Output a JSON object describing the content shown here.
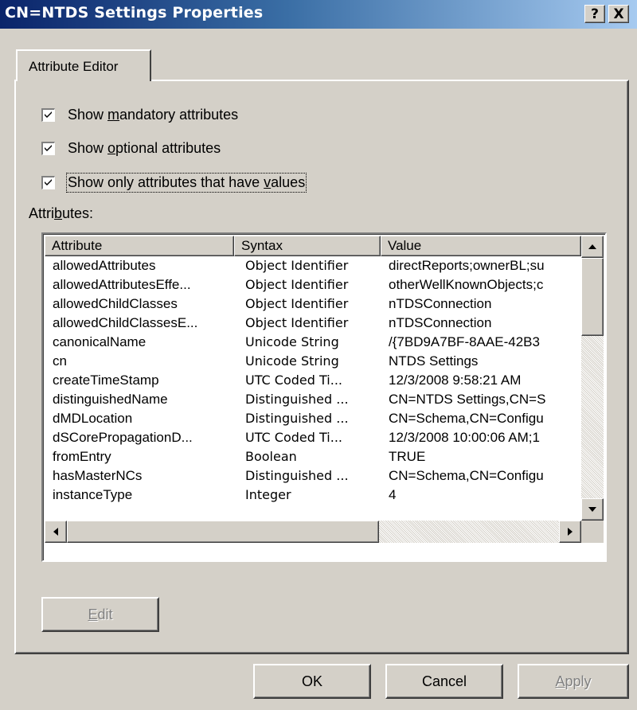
{
  "window": {
    "title": "CN=NTDS Settings Properties",
    "help_label": "?",
    "close_label": "X"
  },
  "tabs": [
    {
      "label": "Attribute Editor"
    }
  ],
  "options": {
    "mandatory": {
      "pre": "Show ",
      "key": "m",
      "post": "andatory attributes",
      "checked": true
    },
    "optional": {
      "pre": "Show ",
      "key": "o",
      "post": "ptional attributes",
      "checked": true
    },
    "values_only": {
      "pre": "Show only attributes that have ",
      "key": "v",
      "post": "alues",
      "checked": true
    }
  },
  "attributes_label": {
    "pre": "Attri",
    "key": "b",
    "post": "utes:"
  },
  "table": {
    "columns": [
      "Attribute",
      "Syntax",
      "Value"
    ],
    "rows": [
      [
        "allowedAttributes",
        "Object Identifier",
        "directReports;ownerBL;su"
      ],
      [
        "allowedAttributesEffe...",
        "Object Identifier",
        "otherWellKnownObjects;c"
      ],
      [
        "allowedChildClasses",
        "Object Identifier",
        "nTDSConnection"
      ],
      [
        "allowedChildClassesE...",
        "Object Identifier",
        "nTDSConnection"
      ],
      [
        "canonicalName",
        "Unicode String",
        "/{7BD9A7BF-8AAE-42B3"
      ],
      [
        "cn",
        "Unicode String",
        "NTDS Settings"
      ],
      [
        "createTimeStamp",
        "UTC Coded Ti...",
        "12/3/2008 9:58:21 AM"
      ],
      [
        "distinguishedName",
        "Distinguished ...",
        "CN=NTDS Settings,CN=S"
      ],
      [
        "dMDLocation",
        "Distinguished ...",
        "CN=Schema,CN=Configu"
      ],
      [
        "dSCorePropagationD...",
        "UTC Coded Ti...",
        "12/3/2008 10:00:06 AM;1"
      ],
      [
        "fromEntry",
        "Boolean",
        "TRUE"
      ],
      [
        "hasMasterNCs",
        "Distinguished ...",
        "CN=Schema,CN=Configu"
      ],
      [
        "instanceType",
        "Integer",
        "4"
      ]
    ]
  },
  "buttons": {
    "edit": {
      "key": "E",
      "post": "dit",
      "enabled": false
    },
    "ok": "OK",
    "cancel": "Cancel",
    "apply": {
      "key": "A",
      "post": "pply",
      "enabled": false
    }
  },
  "icons": {
    "checkmark": "checkmark-icon",
    "scroll_up": "arrow-up-icon",
    "scroll_down": "arrow-down-icon",
    "scroll_left": "arrow-left-icon",
    "scroll_right": "arrow-right-icon"
  }
}
